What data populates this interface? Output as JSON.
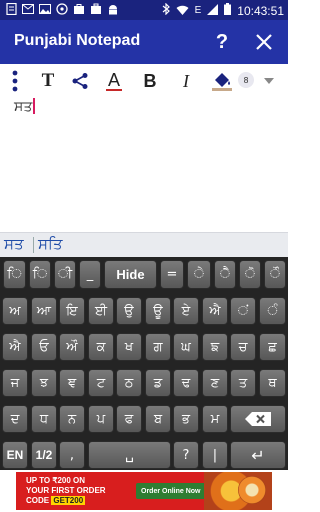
{
  "status_bar": {
    "time": "10:43:51",
    "network_label": "E",
    "left_icons": [
      "document-icon",
      "email-icon",
      "image-icon",
      "whatsapp-icon",
      "bag-icon",
      "briefcase-icon",
      "android-icon"
    ],
    "right_icons": [
      "bluetooth-icon",
      "wifi-icon",
      "signal-icon",
      "battery-icon"
    ]
  },
  "app_bar": {
    "title": "Punjabi Notepad",
    "help_label": "?",
    "background": "#2433a6"
  },
  "toolbar": {
    "bold_label": "B",
    "italic_label": "I",
    "text_label": "T",
    "color_label": "A",
    "font_size": "8",
    "accent": "#c62828"
  },
  "editor": {
    "content": "ਸਤ"
  },
  "suggestions": {
    "items": [
      "ਸਤ",
      "ਸਤਿ"
    ]
  },
  "keyboard": {
    "rows": [
      [
        "ਿ",
        "ਿ",
        "ੀ",
        "_",
        "Hide",
        "=",
        "ੇ",
        "ੈ",
        "ੋ",
        "ੌ"
      ],
      [
        "ਅ",
        "ਆ",
        "ਇ",
        "ਈ",
        "ਉ",
        "ਊ",
        "ਏ",
        "ਐ",
        "ਂ",
        "ੰ"
      ],
      [
        "ਐ",
        "ਓ",
        "ਔ",
        "ਕ",
        "ਖ",
        "ਗ",
        "ਘ",
        "ਙ",
        "ਚ",
        "ਛ"
      ],
      [
        "ਜ",
        "ਝ",
        "ਞ",
        "ਟ",
        "ਠ",
        "ਡ",
        "ਢ",
        "ਣ",
        "ਤ",
        "ਥ"
      ],
      [
        "ਦ",
        "ਧ",
        "ਨ",
        "ਪ",
        "ਫ",
        "ਬ",
        "ਭ",
        "ਮ",
        "⌫"
      ],
      [
        "EN",
        "1/2",
        ",",
        "␣",
        "?",
        "|",
        "↵"
      ]
    ]
  },
  "ad": {
    "line1": "UP TO ₹200 ON",
    "line2": "YOUR FIRST ORDER",
    "line3_prefix": "CODE",
    "line3_code": "GET200",
    "cta": "Order Online Now"
  }
}
